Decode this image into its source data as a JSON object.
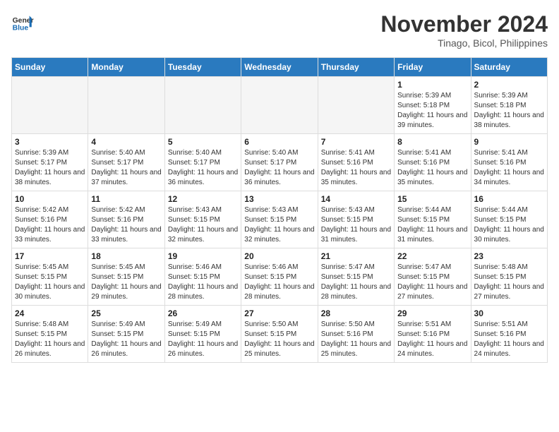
{
  "logo": {
    "line1": "General",
    "line2": "Blue"
  },
  "title": "November 2024",
  "subtitle": "Tinago, Bicol, Philippines",
  "headers": [
    "Sunday",
    "Monday",
    "Tuesday",
    "Wednesday",
    "Thursday",
    "Friday",
    "Saturday"
  ],
  "weeks": [
    [
      {
        "day": "",
        "empty": true
      },
      {
        "day": "",
        "empty": true
      },
      {
        "day": "",
        "empty": true
      },
      {
        "day": "",
        "empty": true
      },
      {
        "day": "",
        "empty": true
      },
      {
        "day": "1",
        "sunrise": "5:39 AM",
        "sunset": "5:18 PM",
        "daylight": "11 hours and 39 minutes."
      },
      {
        "day": "2",
        "sunrise": "5:39 AM",
        "sunset": "5:18 PM",
        "daylight": "11 hours and 38 minutes."
      }
    ],
    [
      {
        "day": "3",
        "sunrise": "5:39 AM",
        "sunset": "5:17 PM",
        "daylight": "11 hours and 38 minutes."
      },
      {
        "day": "4",
        "sunrise": "5:40 AM",
        "sunset": "5:17 PM",
        "daylight": "11 hours and 37 minutes."
      },
      {
        "day": "5",
        "sunrise": "5:40 AM",
        "sunset": "5:17 PM",
        "daylight": "11 hours and 36 minutes."
      },
      {
        "day": "6",
        "sunrise": "5:40 AM",
        "sunset": "5:17 PM",
        "daylight": "11 hours and 36 minutes."
      },
      {
        "day": "7",
        "sunrise": "5:41 AM",
        "sunset": "5:16 PM",
        "daylight": "11 hours and 35 minutes."
      },
      {
        "day": "8",
        "sunrise": "5:41 AM",
        "sunset": "5:16 PM",
        "daylight": "11 hours and 35 minutes."
      },
      {
        "day": "9",
        "sunrise": "5:41 AM",
        "sunset": "5:16 PM",
        "daylight": "11 hours and 34 minutes."
      }
    ],
    [
      {
        "day": "10",
        "sunrise": "5:42 AM",
        "sunset": "5:16 PM",
        "daylight": "11 hours and 33 minutes."
      },
      {
        "day": "11",
        "sunrise": "5:42 AM",
        "sunset": "5:16 PM",
        "daylight": "11 hours and 33 minutes."
      },
      {
        "day": "12",
        "sunrise": "5:43 AM",
        "sunset": "5:15 PM",
        "daylight": "11 hours and 32 minutes."
      },
      {
        "day": "13",
        "sunrise": "5:43 AM",
        "sunset": "5:15 PM",
        "daylight": "11 hours and 32 minutes."
      },
      {
        "day": "14",
        "sunrise": "5:43 AM",
        "sunset": "5:15 PM",
        "daylight": "11 hours and 31 minutes."
      },
      {
        "day": "15",
        "sunrise": "5:44 AM",
        "sunset": "5:15 PM",
        "daylight": "11 hours and 31 minutes."
      },
      {
        "day": "16",
        "sunrise": "5:44 AM",
        "sunset": "5:15 PM",
        "daylight": "11 hours and 30 minutes."
      }
    ],
    [
      {
        "day": "17",
        "sunrise": "5:45 AM",
        "sunset": "5:15 PM",
        "daylight": "11 hours and 30 minutes."
      },
      {
        "day": "18",
        "sunrise": "5:45 AM",
        "sunset": "5:15 PM",
        "daylight": "11 hours and 29 minutes."
      },
      {
        "day": "19",
        "sunrise": "5:46 AM",
        "sunset": "5:15 PM",
        "daylight": "11 hours and 28 minutes."
      },
      {
        "day": "20",
        "sunrise": "5:46 AM",
        "sunset": "5:15 PM",
        "daylight": "11 hours and 28 minutes."
      },
      {
        "day": "21",
        "sunrise": "5:47 AM",
        "sunset": "5:15 PM",
        "daylight": "11 hours and 28 minutes."
      },
      {
        "day": "22",
        "sunrise": "5:47 AM",
        "sunset": "5:15 PM",
        "daylight": "11 hours and 27 minutes."
      },
      {
        "day": "23",
        "sunrise": "5:48 AM",
        "sunset": "5:15 PM",
        "daylight": "11 hours and 27 minutes."
      }
    ],
    [
      {
        "day": "24",
        "sunrise": "5:48 AM",
        "sunset": "5:15 PM",
        "daylight": "11 hours and 26 minutes."
      },
      {
        "day": "25",
        "sunrise": "5:49 AM",
        "sunset": "5:15 PM",
        "daylight": "11 hours and 26 minutes."
      },
      {
        "day": "26",
        "sunrise": "5:49 AM",
        "sunset": "5:15 PM",
        "daylight": "11 hours and 26 minutes."
      },
      {
        "day": "27",
        "sunrise": "5:50 AM",
        "sunset": "5:15 PM",
        "daylight": "11 hours and 25 minutes."
      },
      {
        "day": "28",
        "sunrise": "5:50 AM",
        "sunset": "5:16 PM",
        "daylight": "11 hours and 25 minutes."
      },
      {
        "day": "29",
        "sunrise": "5:51 AM",
        "sunset": "5:16 PM",
        "daylight": "11 hours and 24 minutes."
      },
      {
        "day": "30",
        "sunrise": "5:51 AM",
        "sunset": "5:16 PM",
        "daylight": "11 hours and 24 minutes."
      }
    ]
  ],
  "labels": {
    "sunrise": "Sunrise:",
    "sunset": "Sunset:",
    "daylight": "Daylight:"
  }
}
